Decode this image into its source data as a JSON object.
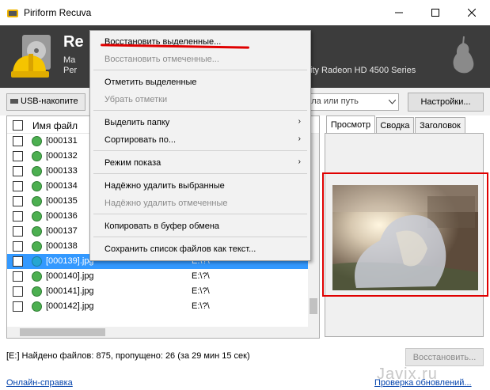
{
  "window": {
    "title": "Piriform Recuva",
    "minimize": "—",
    "maximize": "☐",
    "close": "✕"
  },
  "header": {
    "title": "Re",
    "line1": "Ma",
    "line2": "Per",
    "gpu_text": "ity Radeon HD 4500 Series"
  },
  "toolbar": {
    "drive_label": "USB-накопите",
    "path_placeholder": "айла или путь",
    "settings_button": "Настройки..."
  },
  "file_list": {
    "column_name": "Имя файл",
    "rows": [
      {
        "name": "[000131",
        "path": "",
        "status": "good",
        "selected": false
      },
      {
        "name": "[000132",
        "path": "",
        "status": "good",
        "selected": false
      },
      {
        "name": "[000133",
        "path": "",
        "status": "good",
        "selected": false
      },
      {
        "name": "[000134",
        "path": "",
        "status": "good",
        "selected": false
      },
      {
        "name": "[000135",
        "path": "",
        "status": "good",
        "selected": false
      },
      {
        "name": "[000136",
        "path": "",
        "status": "good",
        "selected": false
      },
      {
        "name": "[000137",
        "path": "",
        "status": "good",
        "selected": false
      },
      {
        "name": "[000138",
        "path": "",
        "status": "good",
        "selected": false
      },
      {
        "name": "[000139].jpg",
        "path": "E:\\?\\",
        "status": "partial",
        "selected": true
      },
      {
        "name": "[000140].jpg",
        "path": "E:\\?\\",
        "status": "good",
        "selected": false
      },
      {
        "name": "[000141].jpg",
        "path": "E:\\?\\",
        "status": "good",
        "selected": false
      },
      {
        "name": "[000142].jpg",
        "path": "E:\\?\\",
        "status": "good",
        "selected": false
      }
    ]
  },
  "preview_tabs": [
    "Просмотр",
    "Сводка",
    "Заголовок"
  ],
  "context_menu": {
    "items": [
      {
        "label": "Восстановить выделенные...",
        "disabled": false,
        "submenu": false
      },
      {
        "label": "Восстановить отмеченные...",
        "disabled": true,
        "submenu": false
      },
      {
        "label": "Отметить выделенные",
        "disabled": false,
        "submenu": false
      },
      {
        "label": "Убрать отметки",
        "disabled": true,
        "submenu": false
      },
      {
        "label": "Выделить папку",
        "disabled": false,
        "submenu": true
      },
      {
        "label": "Сортировать по...",
        "disabled": false,
        "submenu": true
      },
      {
        "label": "Режим показа",
        "disabled": false,
        "submenu": true
      },
      {
        "label": "Надёжно удалить выбранные",
        "disabled": false,
        "submenu": false
      },
      {
        "label": "Надёжно удалить отмеченные",
        "disabled": true,
        "submenu": false
      },
      {
        "label": "Копировать в буфер обмена",
        "disabled": false,
        "submenu": false
      },
      {
        "label": "Сохранить список файлов как текст...",
        "disabled": false,
        "submenu": false
      }
    ]
  },
  "status": {
    "text": "[E:] Найдено файлов: 875, пропущено: 26 (за 29 мин 15 сек)",
    "recover_button": "Восстановить...",
    "help_link": "Онлайн-справка",
    "update_link": "Проверка обновлений...",
    "watermark": "Javix.ru"
  },
  "colors": {
    "accent": "#3399ff",
    "header_bg": "#3c3c3c",
    "highlight": "#e00000",
    "good_status": "#4caf50",
    "partial_status": "#26a6d1"
  }
}
